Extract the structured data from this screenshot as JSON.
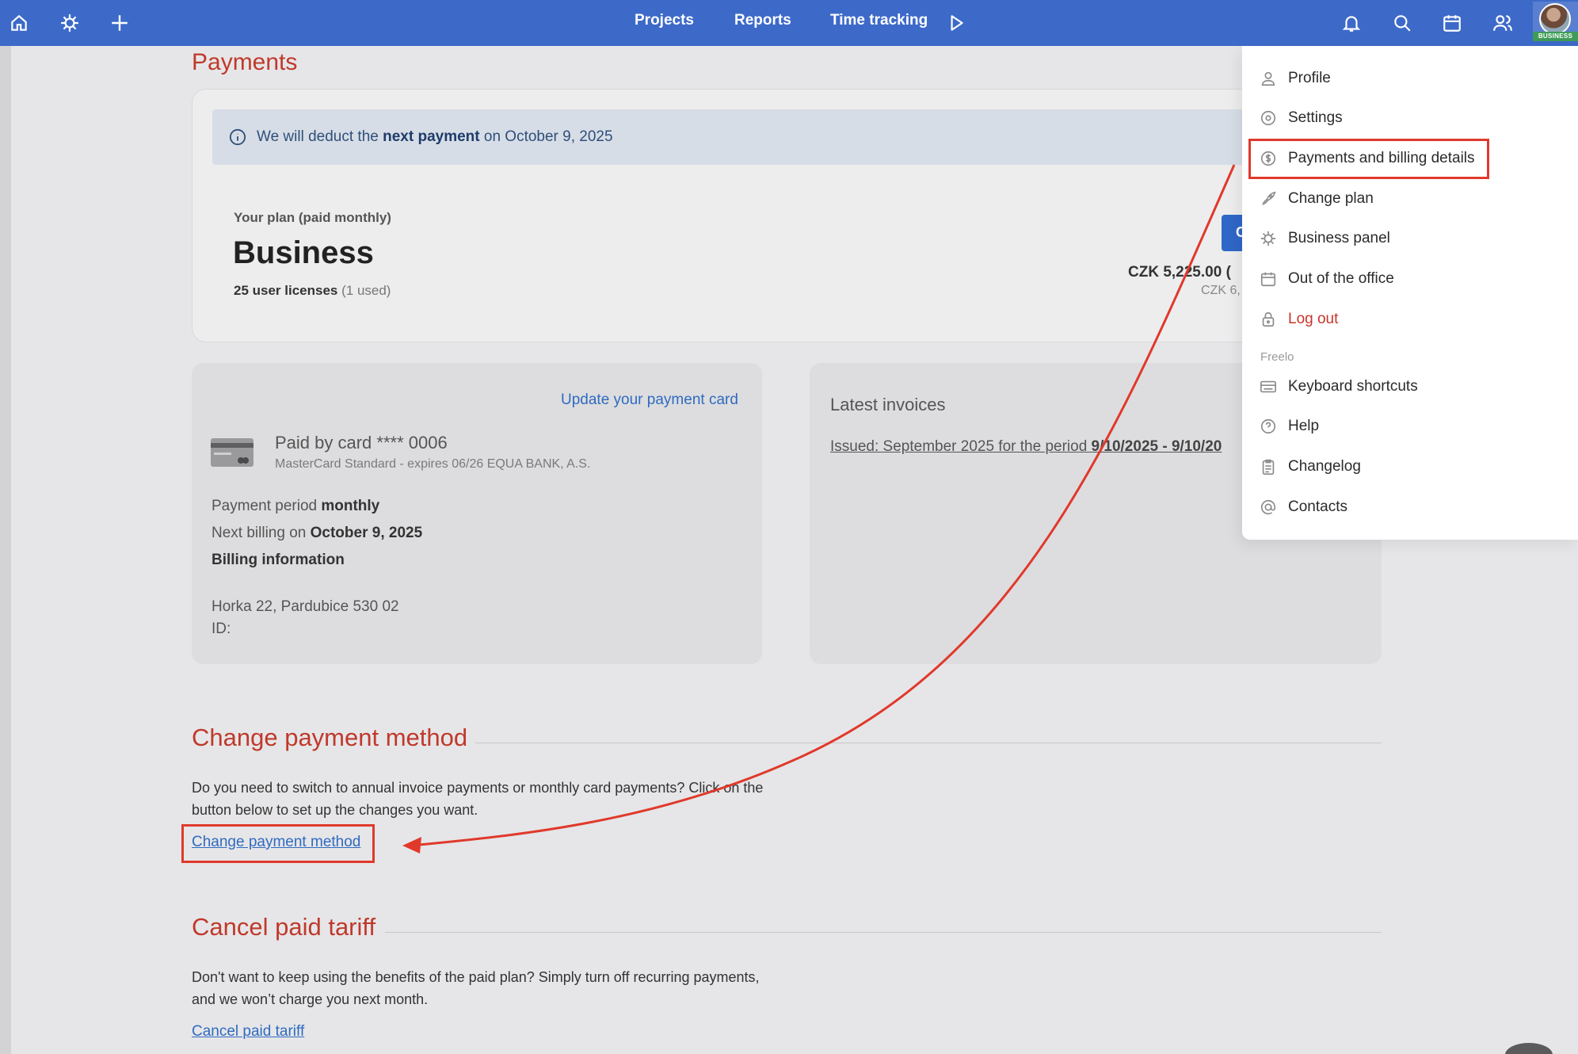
{
  "topbar": {
    "nav": [
      "Projects",
      "Reports",
      "Time tracking"
    ],
    "avatar_badge": "BUSINESS",
    "colors": {
      "bar": "#3d6ac9"
    },
    "icons": [
      "home-icon",
      "business-wheel-icon",
      "plus-icon",
      "play-icon",
      "bell-icon",
      "search-icon",
      "calendar-icon",
      "users-icon"
    ]
  },
  "page": {
    "title": "Payments",
    "info_banner": {
      "before": "We will deduct the ",
      "bold": "next payment",
      "after": " on October 9, 2025"
    },
    "plan": {
      "label": "Your plan (paid monthly)",
      "name": "Business",
      "licenses": "25 user licenses",
      "licenses_used": "(1 used)",
      "button_partial": "C",
      "price": "CZK 5,225.00 (",
      "price_secondary": "CZK 6,"
    },
    "payment_card": {
      "update_link": "Update your payment card",
      "paid_by": "Paid by card **** 0006",
      "card_details": "MasterCard Standard - expires 06/26 EQUA BANK, A.S.",
      "period_label": "Payment period ",
      "period_value": "monthly",
      "next_billing_label": "Next billing on ",
      "next_billing_value": "October 9, 2025",
      "billing_info": "Billing information",
      "address": "Horka 22, Pardubice 530 02",
      "id_label": "ID:"
    },
    "invoices": {
      "title": "Latest invoices",
      "item_prefix": "Issued: September 2025 for the period ",
      "item_period": "9/10/2025 - 9/10/20"
    },
    "change_payment": {
      "title": "Change payment method",
      "line1": "Do you need to switch to annual invoice payments or monthly card payments? Click on the",
      "line2": "button below to set up the changes you want.",
      "link": "Change payment method"
    },
    "cancel_tariff": {
      "title": "Cancel paid tariff",
      "line1": "Don't want to keep using the benefits of the paid plan? Simply turn off recurring payments,",
      "line2": "and we won’t charge you next month.",
      "link": "Cancel paid tariff"
    }
  },
  "dropdown": {
    "items": [
      {
        "label": "Profile",
        "icon": "user-icon"
      },
      {
        "label": "Settings",
        "icon": "gear-icon"
      },
      {
        "label": "Payments and billing details",
        "icon": "dollar-icon"
      },
      {
        "label": "Change plan",
        "icon": "rocket-icon"
      },
      {
        "label": "Business panel",
        "icon": "business-wheel-icon"
      },
      {
        "label": "Out of the office",
        "icon": "calendar-icon"
      },
      {
        "label": "Log out",
        "icon": "lock-icon"
      }
    ],
    "section_label": "Freelo",
    "section_items": [
      {
        "label": "Keyboard shortcuts",
        "icon": "keyboard-icon"
      },
      {
        "label": "Help",
        "icon": "help-icon"
      },
      {
        "label": "Changelog",
        "icon": "clipboard-icon"
      },
      {
        "label": "Contacts",
        "icon": "at-icon"
      }
    ]
  },
  "annotation": {
    "color": "#e0392b"
  }
}
